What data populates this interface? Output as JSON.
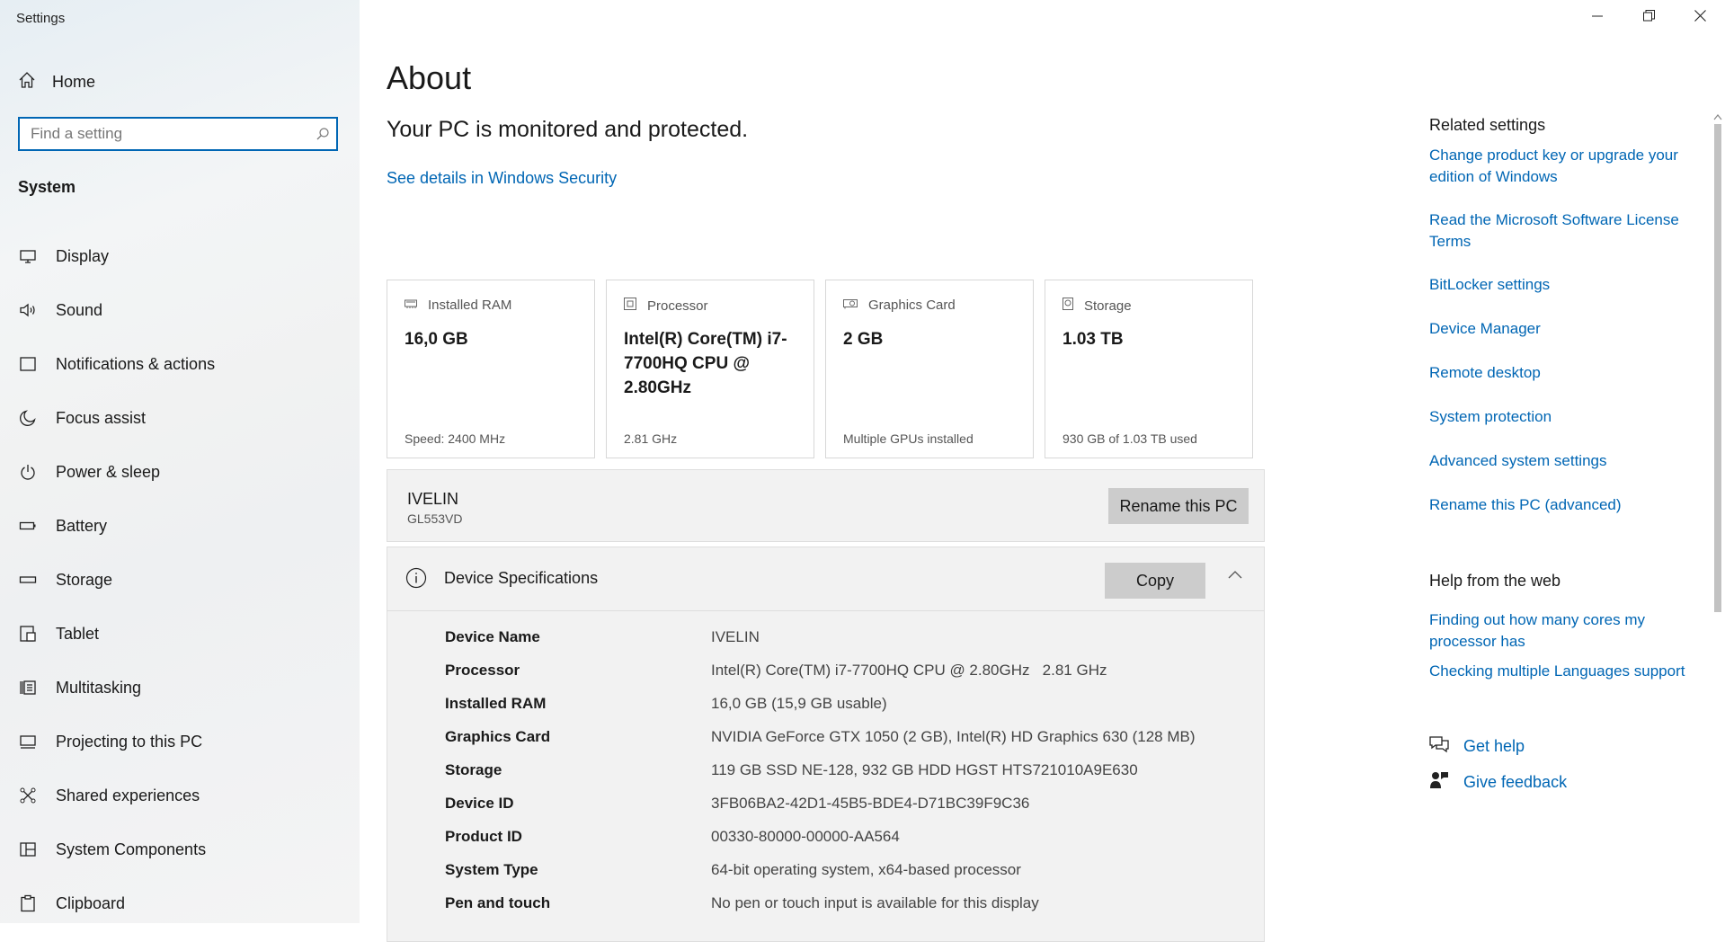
{
  "app": {
    "title": "Settings"
  },
  "window": {
    "minimize": "minimize",
    "restore": "restore",
    "close": "close"
  },
  "sidebar": {
    "home_label": "Home",
    "search_placeholder": "Find a setting",
    "section": "System",
    "items": [
      {
        "label": "Display",
        "icon": "display-icon"
      },
      {
        "label": "Sound",
        "icon": "sound-icon"
      },
      {
        "label": "Notifications & actions",
        "icon": "notifications-icon"
      },
      {
        "label": "Focus assist",
        "icon": "moon-icon"
      },
      {
        "label": "Power & sleep",
        "icon": "power-icon"
      },
      {
        "label": "Battery",
        "icon": "battery-icon"
      },
      {
        "label": "Storage",
        "icon": "storage-icon"
      },
      {
        "label": "Tablet",
        "icon": "tablet-icon"
      },
      {
        "label": "Multitasking",
        "icon": "multitasking-icon"
      },
      {
        "label": "Projecting to this PC",
        "icon": "projecting-icon"
      },
      {
        "label": "Shared experiences",
        "icon": "shared-icon"
      },
      {
        "label": "System Components",
        "icon": "components-icon"
      },
      {
        "label": "Clipboard",
        "icon": "clipboard-icon"
      }
    ]
  },
  "main": {
    "title": "About",
    "protection": "Your PC is monitored and protected.",
    "security_link": "See details in Windows Security",
    "cards": [
      {
        "title": "Installed RAM",
        "value": "16,0 GB",
        "sub": "Speed: 2400 MHz",
        "icon": "ram-icon"
      },
      {
        "title": "Processor",
        "value": "Intel(R) Core(TM) i7-7700HQ CPU @ 2.80GHz",
        "sub": "2.81 GHz",
        "icon": "cpu-icon"
      },
      {
        "title": "Graphics Card",
        "value": "2 GB",
        "sub": "Multiple GPUs installed",
        "icon": "gpu-icon"
      },
      {
        "title": "Storage",
        "value": "1.03 TB",
        "sub": "930 GB of 1.03 TB used",
        "icon": "drive-icon"
      }
    ],
    "pc": {
      "name": "IVELIN",
      "model": "GL553VD",
      "rename_button": "Rename this PC"
    },
    "specs": {
      "title": "Device Specifications",
      "copy_button": "Copy",
      "rows": [
        {
          "key": "Device Name",
          "value": "IVELIN"
        },
        {
          "key": "Processor",
          "value": "Intel(R) Core(TM) i7-7700HQ CPU @ 2.80GHz   2.81 GHz"
        },
        {
          "key": "Installed RAM",
          "value": "16,0 GB (15,9 GB usable)"
        },
        {
          "key": "Graphics Card",
          "value": "NVIDIA GeForce GTX 1050 (2 GB), Intel(R) HD Graphics 630 (128 MB)"
        },
        {
          "key": "Storage",
          "value": "119 GB SSD NE-128, 932 GB HDD HGST HTS721010A9E630"
        },
        {
          "key": "Device ID",
          "value": "3FB06BA2-42D1-45B5-BDE4-D71BC39F9C36"
        },
        {
          "key": "Product ID",
          "value": "00330-80000-00000-AA564"
        },
        {
          "key": "System Type",
          "value": "64-bit operating system, x64-based processor"
        },
        {
          "key": "Pen and touch",
          "value": "No pen or touch input is available for this display"
        }
      ]
    }
  },
  "related": {
    "heading": "Related settings",
    "links": [
      "Change product key or upgrade your edition of Windows",
      "Read the Microsoft Software License Terms",
      "BitLocker settings",
      "Device Manager",
      "Remote desktop",
      "System protection",
      "Advanced system settings",
      "Rename this PC (advanced)"
    ]
  },
  "help": {
    "heading": "Help from the web",
    "links": [
      "Finding out how many cores my processor has",
      "Checking multiple Languages support"
    ],
    "get_help": "Get help",
    "give_feedback": "Give feedback"
  },
  "colors": {
    "accent": "#0066b4",
    "button": "#cccccc",
    "panel": "#f2f2f2"
  }
}
